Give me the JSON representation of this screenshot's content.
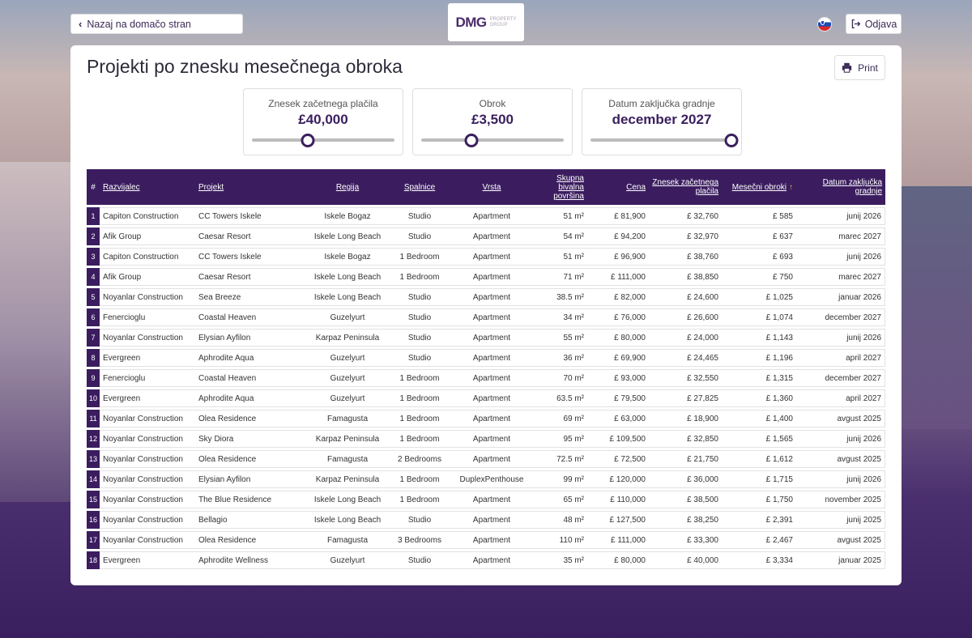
{
  "nav": {
    "back_label": "Nazaj na domačo stran",
    "logout_label": "Odjava"
  },
  "logo": {
    "main": "DMG",
    "sub1": "PROPERTY",
    "sub2": "GROUP"
  },
  "page": {
    "title": "Projekti po znesku mesečnega obroka",
    "print_label": "Print"
  },
  "filters": [
    {
      "label": "Znesek začetnega plačila",
      "value": "£40,000",
      "level": 0.38
    },
    {
      "label": "Obrok",
      "value": "£3,500",
      "level": 0.34
    },
    {
      "label": "Datum zaključka gradnje",
      "value": "december 2027",
      "level": 1.0
    }
  ],
  "table": {
    "headers": [
      "#",
      "Razvijalec",
      "Projekt",
      "Regija",
      "Spalnice",
      "Vrsta",
      "Skupna bivalna površina",
      "Cena",
      "Znesek začetnega plačila",
      "Mesečni obroki",
      "Datum zaključka gradnje"
    ],
    "sort_icon": "sort-arrow-up-icon",
    "rows": [
      [
        "1",
        "Capiton Construction",
        "CC Towers Iskele",
        "Iskele Bogaz",
        "Studio",
        "Apartment",
        "51 m²",
        "£ 81,900",
        "£ 32,760",
        "£ 585",
        "junij 2026"
      ],
      [
        "2",
        "Afik Group",
        "Caesar Resort",
        "Iskele Long Beach",
        "Studio",
        "Apartment",
        "54 m²",
        "£ 94,200",
        "£ 32,970",
        "£ 637",
        "marec 2027"
      ],
      [
        "3",
        "Capiton Construction",
        "CC Towers Iskele",
        "Iskele Bogaz",
        "1 Bedroom",
        "Apartment",
        "51 m²",
        "£ 96,900",
        "£ 38,760",
        "£ 693",
        "junij 2026"
      ],
      [
        "4",
        "Afik Group",
        "Caesar Resort",
        "Iskele Long Beach",
        "1 Bedroom",
        "Apartment",
        "71 m²",
        "£ 111,000",
        "£ 38,850",
        "£ 750",
        "marec 2027"
      ],
      [
        "5",
        "Noyanlar Construction",
        "Sea Breeze",
        "Iskele Long Beach",
        "Studio",
        "Apartment",
        "38.5 m²",
        "£ 82,000",
        "£ 24,600",
        "£ 1,025",
        "januar 2026"
      ],
      [
        "6",
        "Fenercioglu",
        "Coastal Heaven",
        "Guzelyurt",
        "Studio",
        "Apartment",
        "34 m²",
        "£ 76,000",
        "£ 26,600",
        "£ 1,074",
        "december 2027"
      ],
      [
        "7",
        "Noyanlar Construction",
        "Elysian Ayfilon",
        "Karpaz Peninsula",
        "Studio",
        "Apartment",
        "55 m²",
        "£ 80,000",
        "£ 24,000",
        "£ 1,143",
        "junij 2026"
      ],
      [
        "8",
        "Evergreen",
        "Aphrodite Aqua",
        "Guzelyurt",
        "Studio",
        "Apartment",
        "36 m²",
        "£ 69,900",
        "£ 24,465",
        "£ 1,196",
        "april 2027"
      ],
      [
        "9",
        "Fenercioglu",
        "Coastal Heaven",
        "Guzelyurt",
        "1 Bedroom",
        "Apartment",
        "70 m²",
        "£ 93,000",
        "£ 32,550",
        "£ 1,315",
        "december 2027"
      ],
      [
        "10",
        "Evergreen",
        "Aphrodite Aqua",
        "Guzelyurt",
        "1 Bedroom",
        "Apartment",
        "63.5 m²",
        "£ 79,500",
        "£ 27,825",
        "£ 1,360",
        "april 2027"
      ],
      [
        "11",
        "Noyanlar Construction",
        "Olea Residence",
        "Famagusta",
        "1 Bedroom",
        "Apartment",
        "69 m²",
        "£ 63,000",
        "£ 18,900",
        "£ 1,400",
        "avgust 2025"
      ],
      [
        "12",
        "Noyanlar Construction",
        "Sky Diora",
        "Karpaz Peninsula",
        "1 Bedroom",
        "Apartment",
        "95 m²",
        "£ 109,500",
        "£ 32,850",
        "£ 1,565",
        "junij 2026"
      ],
      [
        "13",
        "Noyanlar Construction",
        "Olea Residence",
        "Famagusta",
        "2 Bedrooms",
        "Apartment",
        "72.5 m²",
        "£ 72,500",
        "£ 21,750",
        "£ 1,612",
        "avgust 2025"
      ],
      [
        "14",
        "Noyanlar Construction",
        "Elysian Ayfilon",
        "Karpaz Peninsula",
        "1 Bedroom",
        "DuplexPenthouse",
        "99 m²",
        "£ 120,000",
        "£ 36,000",
        "£ 1,715",
        "junij 2026"
      ],
      [
        "15",
        "Noyanlar Construction",
        "The Blue Residence",
        "Iskele Long Beach",
        "1 Bedroom",
        "Apartment",
        "65 m²",
        "£ 110,000",
        "£ 38,500",
        "£ 1,750",
        "november 2025"
      ],
      [
        "16",
        "Noyanlar Construction",
        "Bellagio",
        "Iskele Long Beach",
        "Studio",
        "Apartment",
        "48 m²",
        "£ 127,500",
        "£ 38,250",
        "£ 2,391",
        "junij 2025"
      ],
      [
        "17",
        "Noyanlar Construction",
        "Olea Residence",
        "Famagusta",
        "3 Bedrooms",
        "Apartment",
        "110 m²",
        "£ 111,000",
        "£ 33,300",
        "£ 2,467",
        "avgust 2025"
      ],
      [
        "18",
        "Evergreen",
        "Aphrodite Wellness",
        "Guzelyurt",
        "Studio",
        "Apartment",
        "35 m²",
        "£ 80,000",
        "£ 40,000",
        "£ 3,334",
        "januar 2025"
      ]
    ]
  }
}
